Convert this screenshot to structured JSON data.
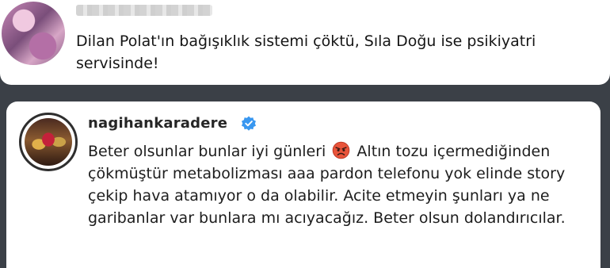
{
  "top_comment": {
    "text": "Dilan Polat'ın bağışıklık sistemi çöktü, Sıla Doğu ise psikiyatri servisinde!"
  },
  "reply": {
    "username": "nagihankaradere",
    "text_before_emoji": "Beter olsunlar bunlar iyi günleri ",
    "emoji": "angry-face-icon",
    "text_after_emoji": " Altın tozu içermediğinden çökmüştür metabolizması aaa pardon telefonu yok elinde story çekip hava atamıyor o da olabilir. Acite etmeyin şunları ya ne garibanlar var bunlara mı acıyacağız. Beter olsun dolandırıcılar."
  },
  "colors": {
    "background": "#3b4047",
    "card": "#ffffff",
    "verified": "#3897f0",
    "text": "#1d1d1d"
  }
}
